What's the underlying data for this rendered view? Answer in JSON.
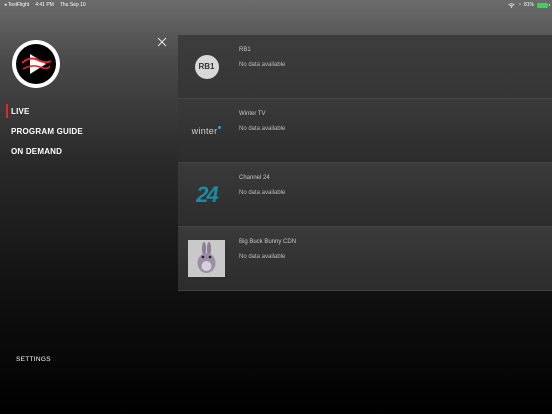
{
  "status_bar": {
    "back_label": "◂ TestFlight",
    "time": "4:41 PM",
    "date": "Thu Sep 10",
    "battery": "81%"
  },
  "drawer": {
    "menu": [
      {
        "label": "LIVE",
        "active": true
      },
      {
        "label": "PROGRAM GUIDE",
        "active": false
      },
      {
        "label": "ON DEMAND",
        "active": false
      }
    ],
    "settings_label": "SETTINGS"
  },
  "channels": [
    {
      "name": "RB1",
      "status": "No data available",
      "logo_text": "RB1"
    },
    {
      "name": "Winter TV",
      "status": "No data available",
      "logo_text": "winter"
    },
    {
      "name": "Channel 24",
      "status": "No data available",
      "logo_text": "24"
    },
    {
      "name": "Big Buck Bunny CDN",
      "status": "No data available",
      "logo_text": ""
    }
  ],
  "colors": {
    "accent": "#e3262e",
    "battery": "#3bd35d",
    "winter_dot": "#1ea7e8",
    "channel24": "#1b8aa3"
  }
}
